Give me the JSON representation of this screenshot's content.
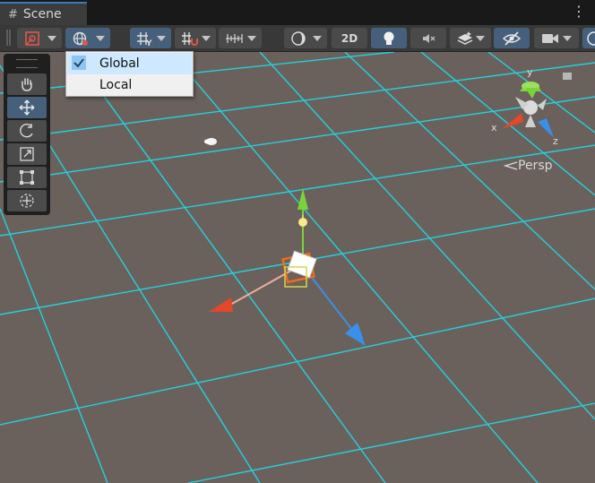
{
  "tab": {
    "title": "Scene"
  },
  "toolbar": {
    "mode_2d_label": "2D"
  },
  "dropdown": {
    "items": [
      {
        "label": "Global",
        "checked": true
      },
      {
        "label": "Local",
        "checked": false
      }
    ]
  },
  "gizmo": {
    "x_label": "x",
    "y_label": "y",
    "z_label": "z",
    "projection_label": "Persp"
  },
  "colors": {
    "grid_line": "#23d1dd",
    "ground": "#6b615c",
    "axis_x": "#e4472a",
    "axis_y": "#7bd33a",
    "axis_z": "#3a8fe8",
    "toolbar_active": "#46607c"
  },
  "tools": [
    "hand-icon",
    "move-icon",
    "rotate-icon",
    "scale-icon",
    "rect-icon",
    "transform-icon"
  ]
}
